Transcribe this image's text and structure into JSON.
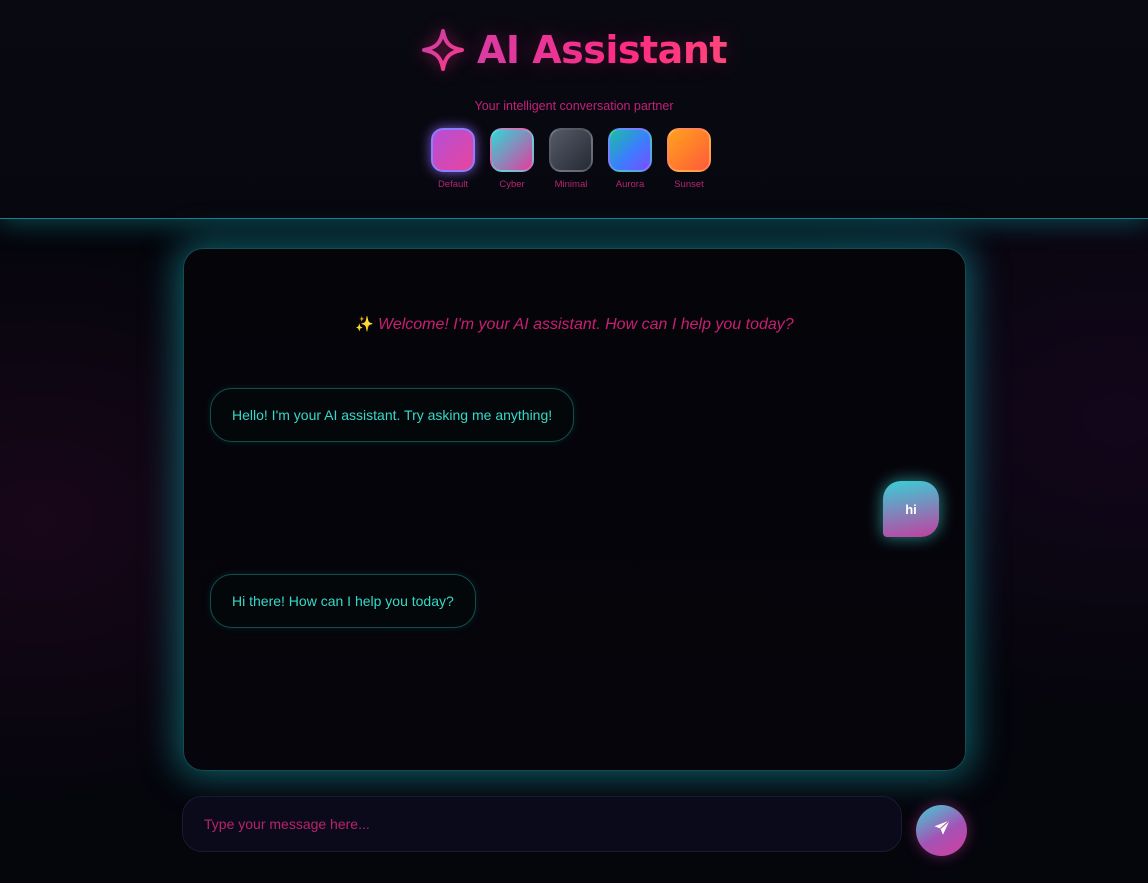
{
  "header": {
    "title": "AI Assistant",
    "subtitle": "Your intelligent conversation partner",
    "logo_icon": "sparkle-icon",
    "themes": [
      {
        "label": "Default",
        "active": true,
        "colors": [
          "#c34bd6",
          "#ef3f9a"
        ]
      },
      {
        "label": "Cyber",
        "active": false,
        "colors": [
          "#34d6da",
          "#e13ea0"
        ]
      },
      {
        "label": "Minimal",
        "active": false,
        "colors": [
          "#4d5260",
          "#2a2e38"
        ]
      },
      {
        "label": "Aurora",
        "active": false,
        "colors": [
          "#1fb6a8",
          "#6a52ff"
        ]
      },
      {
        "label": "Sunset",
        "active": false,
        "colors": [
          "#ff9a1e",
          "#ff5a3c"
        ]
      }
    ]
  },
  "chat": {
    "welcome_icon": "sparkles-icon",
    "welcome_text": "Welcome! I'm your AI assistant. How can I help you today?",
    "messages": [
      {
        "role": "assistant",
        "text": "Hello! I'm your AI assistant. Try asking me anything!"
      },
      {
        "role": "user",
        "text": "hi"
      },
      {
        "role": "assistant",
        "text": "Hi there! How can I help you today?"
      }
    ]
  },
  "composer": {
    "placeholder": "Type your message here...",
    "value": "",
    "send_icon": "send-icon"
  },
  "colors": {
    "accent_pink": "#ff2f86",
    "accent_teal": "#35d9c8",
    "glow_teal": "#14a0aa"
  }
}
